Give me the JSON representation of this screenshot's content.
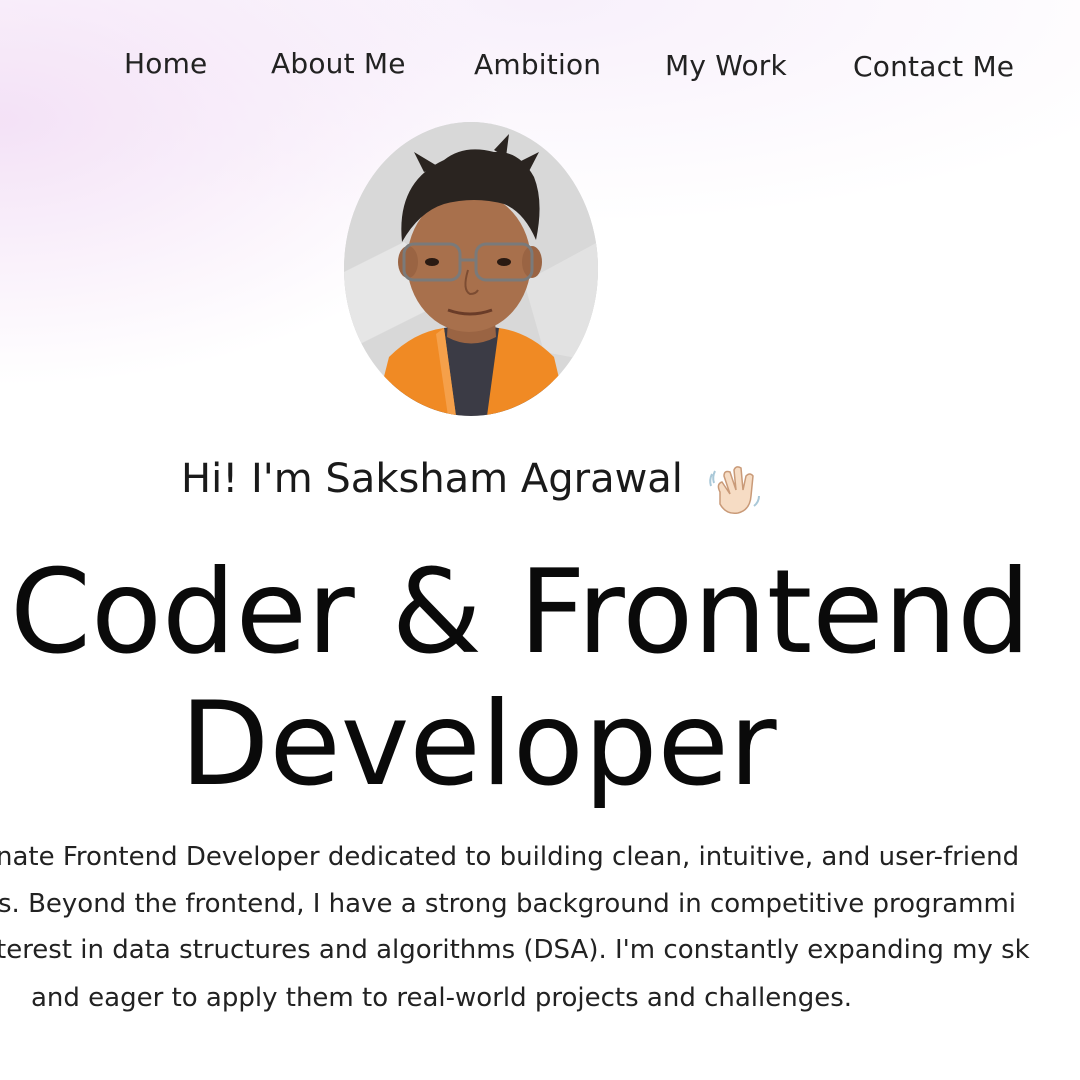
{
  "nav": {
    "items": [
      {
        "label": "Home"
      },
      {
        "label": "About Me"
      },
      {
        "label": "Ambition"
      },
      {
        "label": "My Work"
      },
      {
        "label": "Contact Me"
      }
    ]
  },
  "hero": {
    "greeting": "Hi! I'm Saksham Agrawal",
    "greeting_icon": "waving-hand-icon",
    "headline_line1": "Coder & Frontend",
    "headline_line2": "Developer",
    "bio_lines": [
      "nate Frontend Developer dedicated to building clean, intuitive, and user-friend",
      "s. Beyond the frontend, I have a strong background in competitive programmi",
      "terest in data structures and algorithms (DSA). I'm constantly expanding my sk",
      "and eager to apply them to real-world projects and challenges."
    ]
  },
  "colors": {
    "background": "#ffffff",
    "gradient_tint": "#f3e0f6",
    "text": "#111111",
    "avatar_jacket": "#f08a24"
  }
}
